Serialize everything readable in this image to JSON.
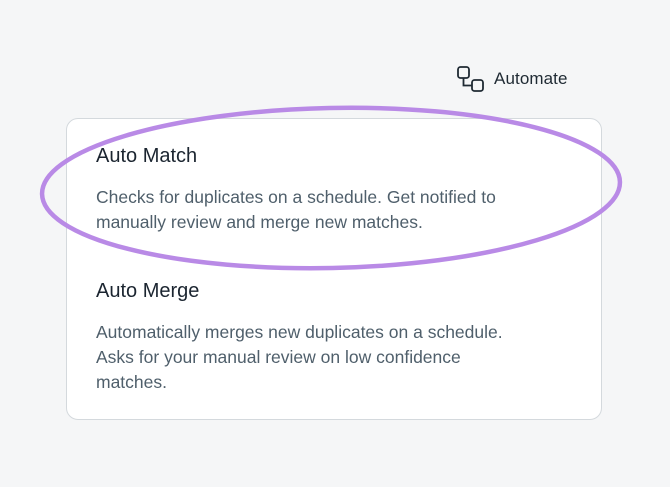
{
  "automate": {
    "label": "Automate",
    "icon": "automation-nodes-icon"
  },
  "options": [
    {
      "title": "Auto Match",
      "description_line1": "Checks for duplicates on a schedule. Get notified to",
      "description_line2": "manually review and merge new matches."
    },
    {
      "title": "Auto Merge",
      "description_line1": "Automatically merges new duplicates on a schedule.",
      "description_line2": "Asks for your manual review on low confidence",
      "description_line3": "matches."
    }
  ],
  "colors": {
    "highlight_ellipse": "#b98ae6",
    "card_border": "#d4d9dd",
    "title_text": "#1b2530",
    "body_text": "#4f5f6b",
    "background": "#f5f6f7"
  }
}
